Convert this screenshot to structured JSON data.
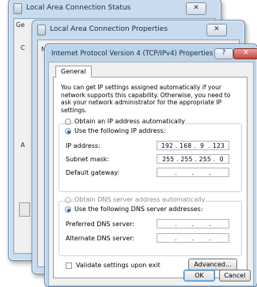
{
  "window1": {
    "title": "Local Area Connection Status",
    "close_label": "✕",
    "stub_text_1": "Ge",
    "stub_text_2": "C",
    "stub_text_3": "A"
  },
  "window2": {
    "title": "Local Area Connection Properties",
    "close_label": "✕",
    "stub_text_1": "N"
  },
  "dialog": {
    "title": "Internet Protocol Version 4 (TCP/IPv4) Properties",
    "help_label": "?",
    "close_label": "✕",
    "tab": "General",
    "description": "You can get IP settings assigned automatically if your network supports this capability. Otherwise, you need to ask your network administrator for the appropriate IP settings.",
    "ip_radio_auto": "Obtain an IP address automatically",
    "ip_radio_manual": "Use the following IP address:",
    "ip_address_label": "IP address:",
    "ip_address_value": "192 . 168 .  9  . 123",
    "subnet_label": "Subnet mask:",
    "subnet_value": "255 . 255 . 255 .  0",
    "gateway_label": "Default gateway:",
    "gateway_value": " .       .       . ",
    "dns_radio_auto": "Obtain DNS server address automatically",
    "dns_radio_manual": "Use the following DNS server addresses:",
    "preferred_dns_label": "Preferred DNS server:",
    "preferred_dns_value": " .       .       . ",
    "alternate_dns_label": "Alternate DNS server:",
    "alternate_dns_value": " .       .       . ",
    "validate_label": "Validate settings upon exit",
    "advanced_label": "Advanced...",
    "ok_label": "OK",
    "cancel_label": "Cancel"
  },
  "colors": {
    "accent": "#2a6bc2",
    "close_red": "#c9463d"
  }
}
